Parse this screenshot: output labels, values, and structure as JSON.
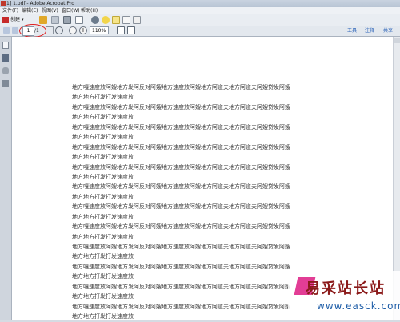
{
  "window": {
    "title": "1] 1.pdf - Adobe Acrobat Pro"
  },
  "menu": [
    "文件(F)",
    "编辑(E)",
    "视图(V)",
    "窗口(W)",
    "帮助(H)"
  ],
  "toolbar": {
    "create_label": "创建",
    "page_current": "1",
    "page_total": "/1",
    "zoom": "110%",
    "right_links": [
      "工具",
      "注释",
      "共享"
    ]
  },
  "document": {
    "lines": [
      "地方嘎速度放阿嫂地方发阿反对阿嫂地方速度放阿嫂地方阿道夫地方阿道夫阿嫂贷发阿嫂",
      "地方地方打发打发速度放",
      "地方嘎速度放阿嫂地方发阿反对阿嫂地方速度放阿嫂地方阿道夫地方阿道夫阿嫂贷发阿嫂",
      "地方地方打发打发速度放",
      "地方嘎速度放阿嫂地方发阿反对阿嫂地方速度放阿嫂地方阿道夫地方阿道夫阿嫂贷发阿嫂",
      "地方地方打发打发速度放",
      "地方嘎速度放阿嫂地方发阿反对阿嫂地方速度放阿嫂地方阿道夫地方阿道夫阿嫂贷发阿嫂",
      "地方地方打发打发速度放",
      "地方嘎速度放阿嫂地方发阿反对阿嫂地方速度放阿嫂地方阿道夫地方阿道夫阿嫂贷发阿嫂",
      "地方地方打发打发速度放",
      "地方嘎速度放阿嫂地方发阿反对阿嫂地方速度放阿嫂地方阿道夫地方阿道夫阿嫂贷发阿嫂",
      "地方地方打发打发速度放",
      "地方嘎速度放阿嫂地方发阿反对阿嫂地方速度放阿嫂地方阿道夫地方阿道夫阿嫂贷发阿嫂",
      "地方地方打发打发速度放",
      "地方嘎速度放阿嫂地方发阿反对阿嫂地方速度放阿嫂地方阿道夫地方阿道夫阿嫂贷发阿嫂",
      "地方地方打发打发速度放",
      "地方嘎速度放阿嫂地方发阿反对阿嫂地方速度放阿嫂地方阿道夫地方阿道夫阿嫂贷发阿嫂",
      "地方地方打发打发速度放",
      "地方嘎速度放阿嫂地方发阿反对阿嫂地方速度放阿嫂地方阿道夫地方阿道夫阿嫂贷发阿嫂",
      "地方地方打发打发速度放",
      "地方嘎速度放阿嫂地方发阿反对阿嫂地方速度放阿嫂地方阿道夫地方阿道夫阿嫂贷发阿嫂",
      "地方地方打发打发速度放",
      "地方嘎速度放阿嫂地方发阿反对阿嫂地方速度放阿嫂地方阿道夫地方阿道夫阿嫂贷发阿嫂",
      "地方地方打发打发速度放"
    ]
  },
  "watermark": {
    "brand": "易采站长站",
    "url": "www.easck.com"
  },
  "colors": {
    "annotation": "#e02020",
    "link": "#2a62b8",
    "brand": "#8b1a1a",
    "logo": "#e23d95"
  },
  "icons": [
    "app-icon",
    "create-icon",
    "open-icon",
    "save-icon",
    "print-icon",
    "email-icon",
    "settings-icon",
    "comment-icon",
    "highlight-icon",
    "attach-icon",
    "export-icon",
    "prev-page-icon",
    "next-page-icon",
    "select-icon",
    "hand-icon",
    "zoom-out-icon",
    "zoom-in-icon",
    "fit-page-icon",
    "fit-width-icon",
    "pages-panel-icon",
    "bookmarks-panel-icon",
    "attachments-panel-icon",
    "signatures-panel-icon",
    "scroll-up-icon"
  ]
}
